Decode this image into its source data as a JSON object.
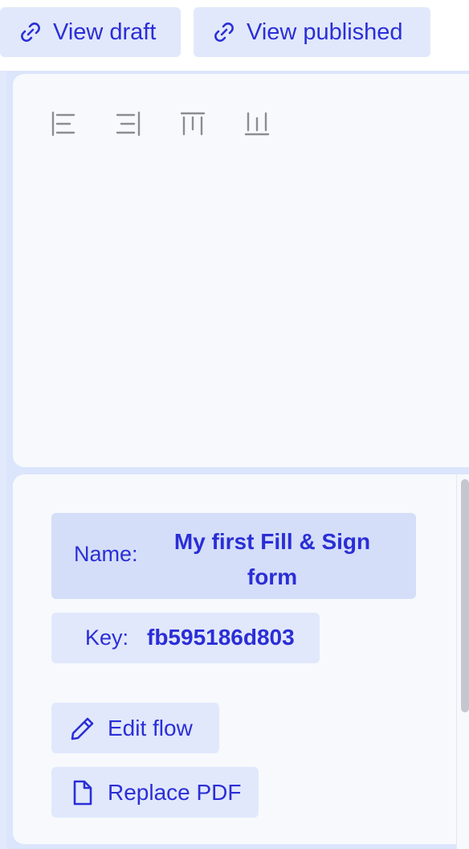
{
  "header": {
    "view_draft_label": "View draft",
    "view_published_label": "View published"
  },
  "toolbar": {
    "icons": [
      "align-left-icon",
      "align-right-icon",
      "align-top-icon",
      "align-bottom-icon"
    ]
  },
  "form": {
    "name_label": "Name:",
    "name_value": "My first Fill & Sign form",
    "key_label": "Key:",
    "key_value": "fb595186d803"
  },
  "actions": {
    "edit_flow_label": "Edit flow",
    "replace_pdf_label": "Replace PDF"
  },
  "colors": {
    "accent": "#2b2ed6",
    "button_bg": "#e1e8fb",
    "name_bg": "#d4def9",
    "panel_bg": "#f7f9fd",
    "icon_gray": "#8a8d93"
  }
}
